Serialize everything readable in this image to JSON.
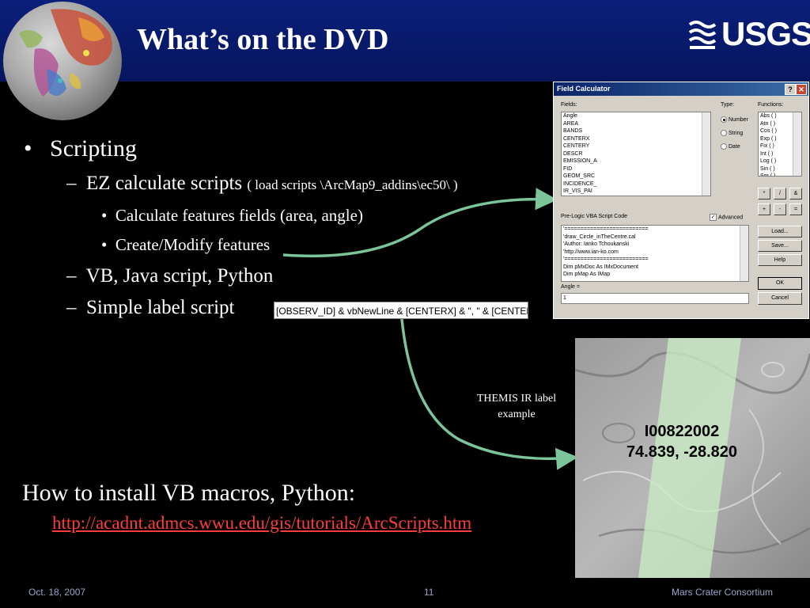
{
  "slide": {
    "title": "What’s on the DVD",
    "logo_text": "USGS",
    "bullets": {
      "l1_marker": "•",
      "scripting": "Scripting",
      "dash": "–",
      "ez_calc": "EZ calculate scripts",
      "ez_calc_note": "( load scripts \\ArcMap9_addins\\ec50\\ )",
      "sub_marker": "•",
      "calc_fields": "Calculate features fields (area, angle)",
      "create_modify": "Create/Modify features",
      "vb_java_python": "VB, Java script, Python",
      "simple_label": "Simple label script"
    },
    "label_expression": "[OBSERV_ID] & vbNewLine & [CENTERX]  & \", \" & [CENTERY]",
    "caption_line1": "THEMIS IR label",
    "caption_line2": "example",
    "map_label_line1": "I00822002",
    "map_label_line2": "74.839, -28.820",
    "howto": "How to install VB macros, Python:",
    "link": "http://acadnt.admcs.wwu.edu/gis/tutorials/ArcScripts.htm"
  },
  "dialog": {
    "title": "Field Calculator",
    "help_btn": "?",
    "close_btn": "✕",
    "fields_label": "Fields:",
    "type_label": "Type:",
    "functions_label": "Functions:",
    "fields": [
      "Angle",
      "AREA",
      "BANDS",
      "CENTERX",
      "CENTERY",
      "DESCR",
      "EMISSION_A",
      "FID",
      "GEOM_SRC",
      "INCIDENCE_",
      "IR_VIS_PAI"
    ],
    "types": [
      "Number",
      "String",
      "Date"
    ],
    "selected_type": "Number",
    "functions": [
      "Abs (  )",
      "Atn (  )",
      "Cos (  )",
      "Exp (  )",
      "Fix (  )",
      "Int (  )",
      "Log (  )",
      "Sin (  )",
      "Sqr (  )"
    ],
    "operators": [
      "*",
      "/",
      "&",
      "+",
      "-",
      "="
    ],
    "vba_label": "Pre-Logic VBA Script Code",
    "advanced_label": "Advanced",
    "advanced_checked": "✓",
    "code_lines": [
      "'==========================",
      "'draw_Circle_inTheCentre.cal",
      "'Author: Ianko Tchoukanski",
      "'http://www.ian-ko.com",
      "'==========================",
      "Dim pMxDoc As IMxDocument",
      "Dim pMap As IMap"
    ],
    "load_btn": "Load...",
    "save_btn": "Save...",
    "help_text_btn": "Help",
    "ok_btn": "OK",
    "cancel_btn": "Cancel",
    "angle_label": "Angle =",
    "angle_value": "1"
  },
  "footer": {
    "date": "Oct. 18, 2007",
    "page": "11",
    "org": "Mars Crater Consortium"
  },
  "colors": {
    "header_bg": "#0b1f7a",
    "arrow": "#7cc49a",
    "link": "#ff3b3b",
    "footer_text": "#9aa4c8"
  }
}
